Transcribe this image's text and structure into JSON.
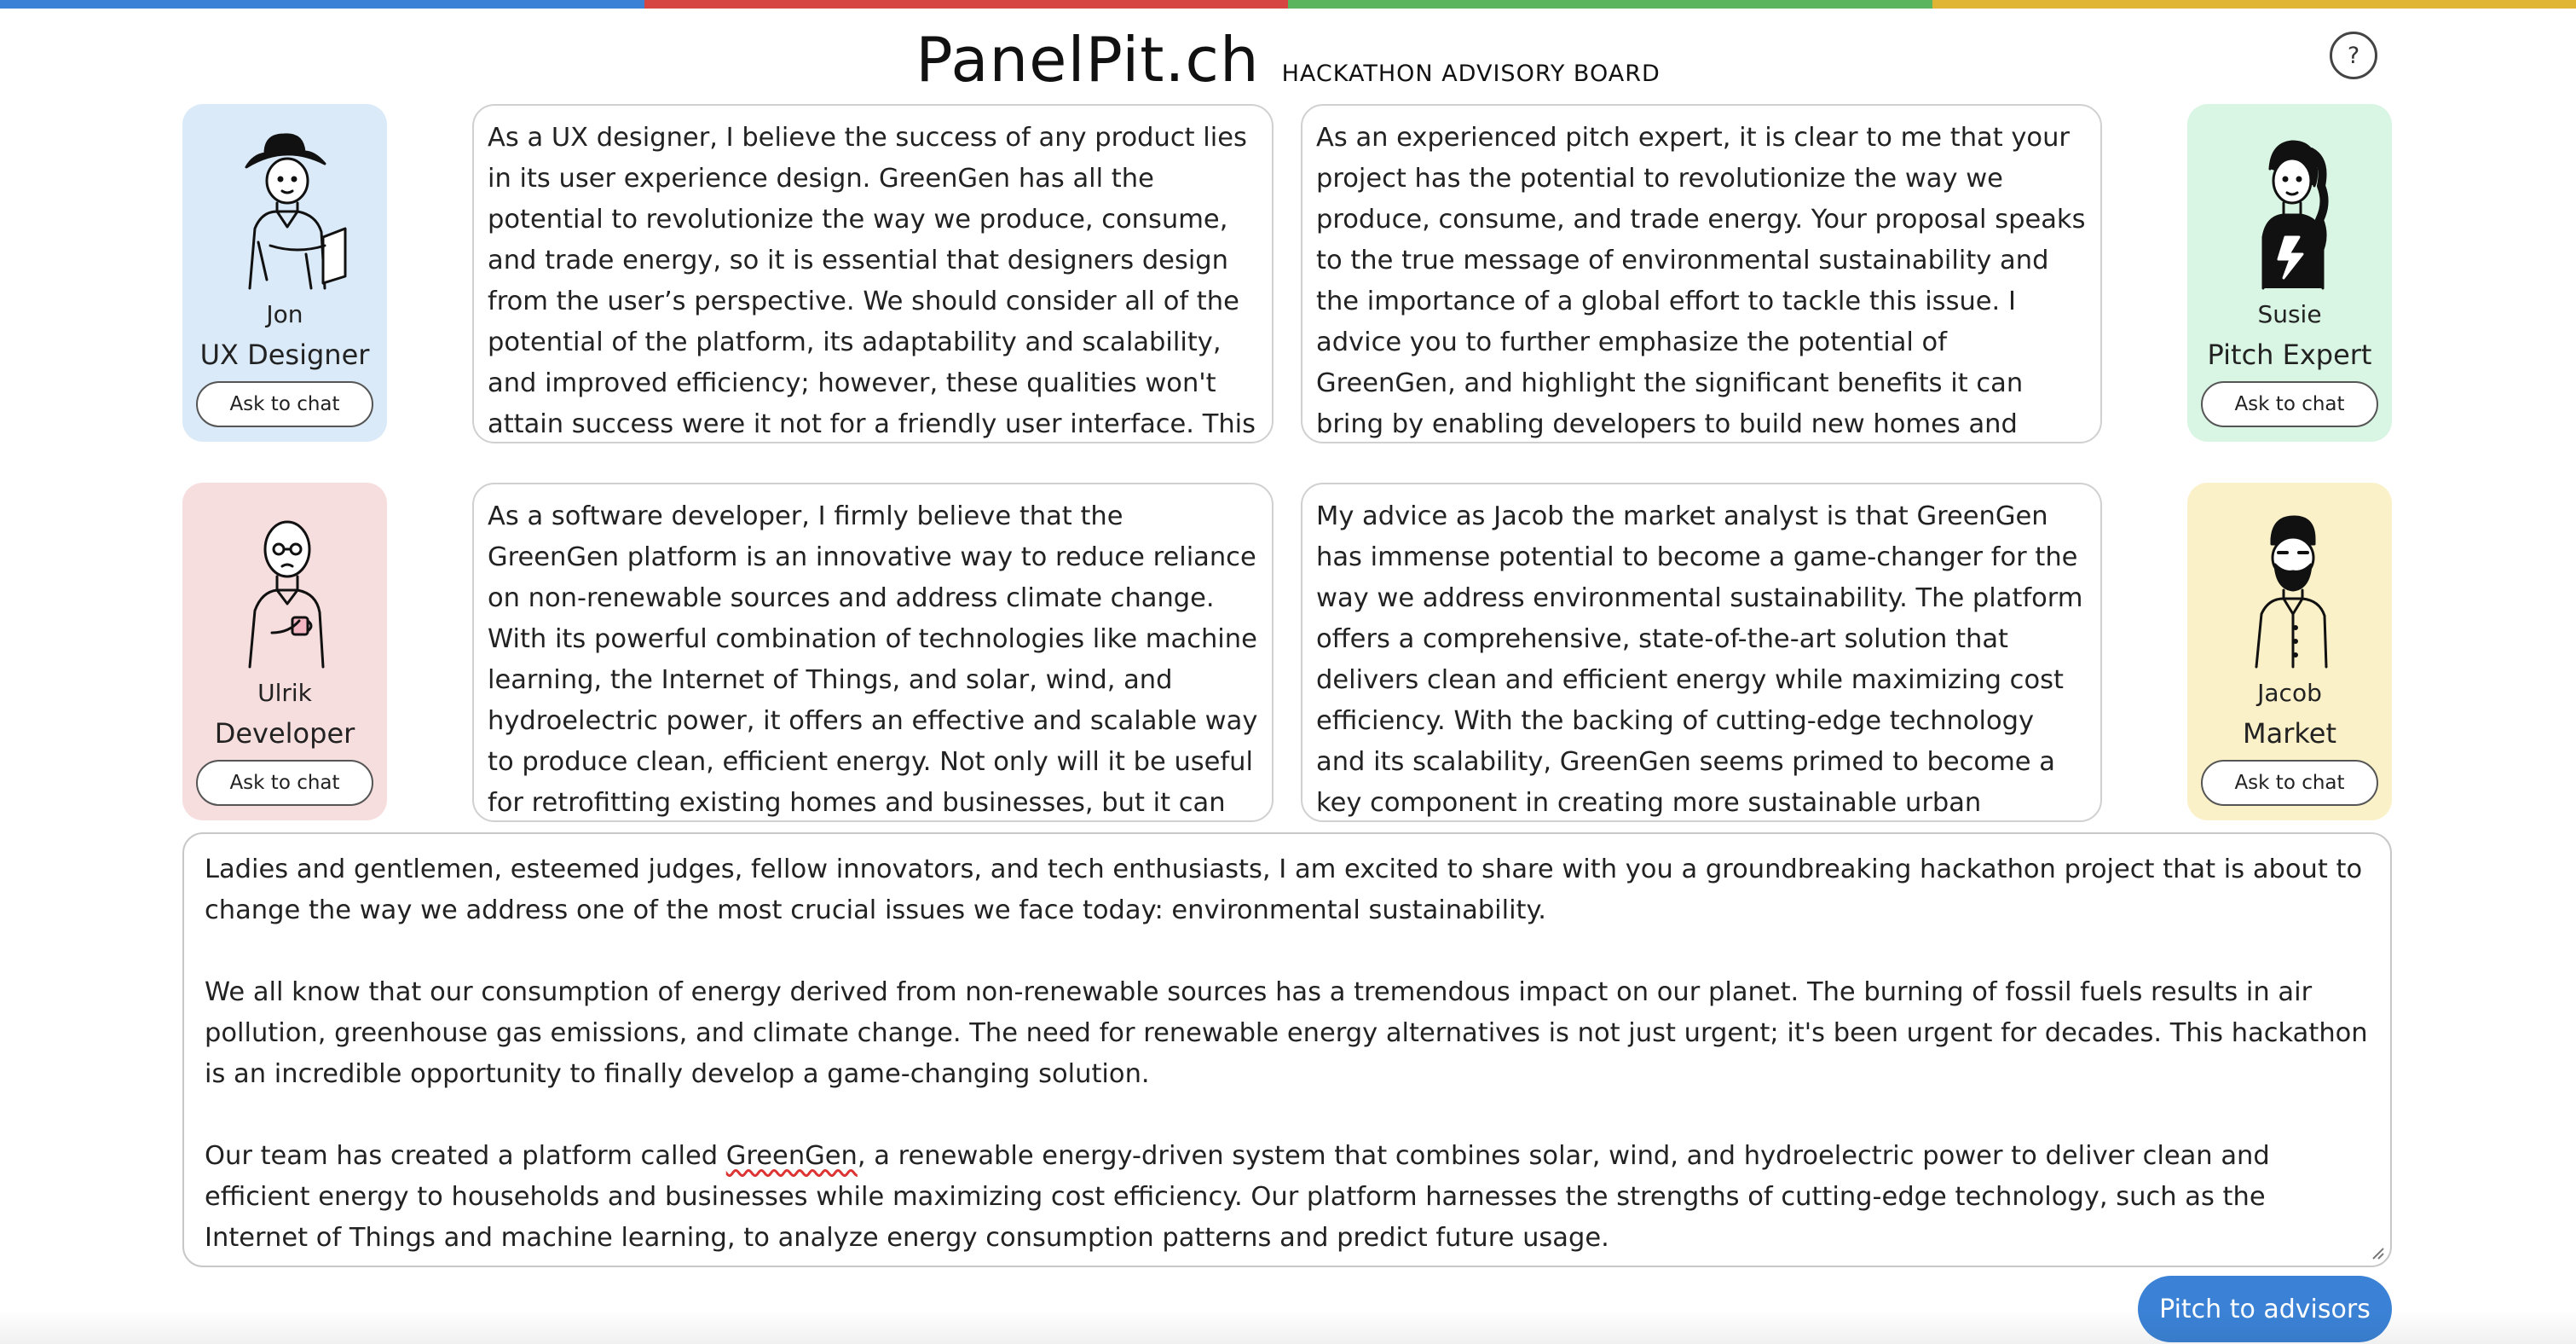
{
  "colors": {
    "topbar": [
      "#3b82d6",
      "#d64541",
      "#5ab55e",
      "#e0b536"
    ],
    "card_bg": {
      "ux": "#daeaf8",
      "pitch": "#d9f5e3",
      "dev": "#f7dede",
      "market": "#fbf1c8"
    },
    "accent": "#3b82d6"
  },
  "header": {
    "logo": "PanelPit.ch",
    "subtitle": "HACKATHON ADVISORY BOARD",
    "help_label": "?"
  },
  "advisors": [
    {
      "name": "Jon",
      "role": "UX Designer",
      "button": "Ask to chat",
      "icon": "person-with-hat-tablet-icon",
      "response": "As a UX designer, I believe the success of any product lies in its user experience design. GreenGen has all the potential to revolutionize the way we produce, consume, and trade energy, so it is essential that designers design from the user’s perspective. We should consider all of the potential of the platform, its adaptability and scalability, and improved efficiency; however, these qualities won't attain success were it not for a friendly user interface. This is where UX designers"
    },
    {
      "name": "Susie",
      "role": "Pitch Expert",
      "button": "Ask to chat",
      "icon": "person-with-braid-icon",
      "response": "As an experienced pitch expert, it is clear to me that your project has the potential to revolutionize the way we produce, consume, and trade energy. Your proposal speaks to the true message of environmental sustainability and the importance of a global effort to tackle this issue. I advice you to further emphasize the potential of GreenGen, and highlight the significant benefits it can bring by enabling developers to build new homes and commercial spaces with"
    },
    {
      "name": "Ulrik",
      "role": "Developer",
      "button": "Ask to chat",
      "icon": "bald-person-with-mug-icon",
      "response": "As a software developer, I firmly believe that the GreenGen platform is an innovative way to reduce reliance on non-renewable sources and address climate change. With its powerful combination of technologies like machine learning, the Internet of Things, and solar, wind, and hydroelectric power, it offers an effective and scalable way to produce clean, efficient energy. Not only will it be useful for retrofitting existing homes and businesses, but it can help"
    },
    {
      "name": "Jacob",
      "role": "Market",
      "button": "Ask to chat",
      "icon": "bearded-person-icon",
      "response": "My advice as Jacob the market analyst is that GreenGen has immense potential to become a game-changer for the way we address environmental sustainability. The platform offers a comprehensive, state-of-the-art solution that delivers clean and efficient energy while maximizing cost efficiency. With the backing of cutting-edge technology and its scalability, GreenGen seems primed to become a key component in creating more sustainable urban spaces. Furthermore,"
    }
  ],
  "pitch": {
    "p1": "Ladies and gentlemen, esteemed judges, fellow innovators, and tech enthusiasts, I am excited to share with you a groundbreaking hackathon project that is about to change the way we address one of the most crucial issues we face today: environmental sustainability.",
    "p2": "We all know that our consumption of energy derived from non-renewable sources has a tremendous impact on our planet. The burning of fossil fuels results in air pollution, greenhouse gas emissions, and climate change. The need for renewable energy alternatives is not just urgent; it's been urgent for decades. This hackathon is an incredible opportunity to finally develop a game-changing solution.",
    "p3_before": "Our team has created a platform called ",
    "p3_word": "GreenGen",
    "p3_after": ", a renewable energy-driven system that combines solar, wind, and hydroelectric power to deliver clean and efficient energy to households and businesses while maximizing cost efficiency. Our platform harnesses the strengths of cutting-edge technology, such as the Internet of Things and machine learning, to analyze energy consumption patterns and predict future usage."
  },
  "pitch_button": "Pitch to advisors"
}
